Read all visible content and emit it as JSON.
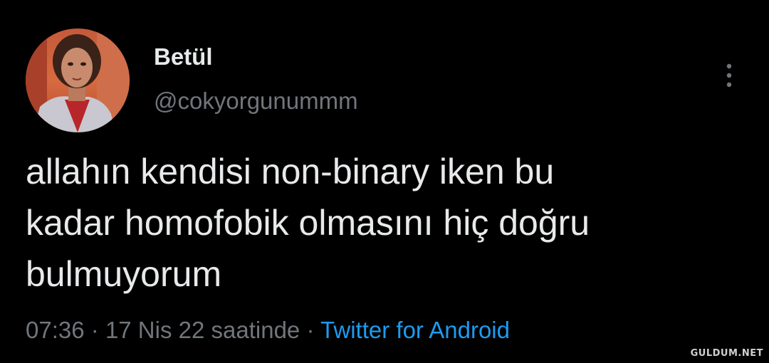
{
  "tweet": {
    "author": {
      "display_name": "Betül",
      "handle": "@cokyorgunummm",
      "avatar_icon": "profile-photo"
    },
    "text": "allahın kendisi non-binary iken bu\nkadar homofobik olmasını hiç doğru\nbulmuyorum",
    "timestamp": "07:36",
    "separator": "·",
    "date_text": "17 Nis 22 saatinde",
    "source": "Twitter for Android",
    "more_icon": "more-vertical-icon"
  },
  "watermark": "GULDUM.NET",
  "colors": {
    "background": "#000000",
    "primary_text": "#e7e9ea",
    "secondary_text": "#71767b",
    "link": "#1d9bf0"
  }
}
